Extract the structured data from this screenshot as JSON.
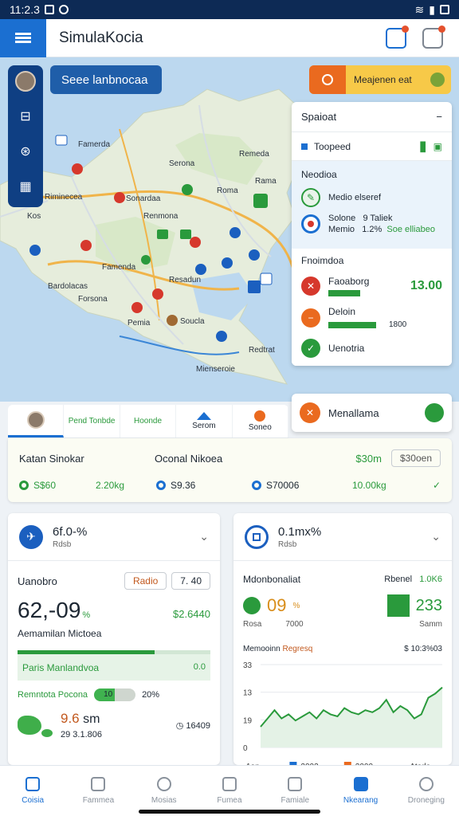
{
  "status_bar": {
    "time": "11:2.3"
  },
  "app": {
    "title": "SimulaKocia"
  },
  "map": {
    "search_label": "Seee lanbnocaa",
    "promo_label": "Meajenen eat",
    "labels": [
      "Famerda",
      "Remeda",
      "Serona",
      "Roma",
      "Sonardaa",
      "Riminecea",
      "Kos",
      "Renmona",
      "Famenda",
      "Forsona",
      "Pemia",
      "Bardolacas",
      "Soucla",
      "Rama",
      "Resadun",
      "Redtrat",
      "Mienseroie"
    ]
  },
  "panel": {
    "title": "Spaioat",
    "row_label": "Toopeed",
    "section_title": "Neodioa",
    "section_item": "Medio elseref",
    "stat_a_label": "Solone",
    "stat_a_value": "9 Taliek",
    "stat_b_label": "Memio",
    "stat_b_value": "1.2%",
    "stat_b_tail": "Soe elliabeo",
    "finance_title": "Fnoimdoa",
    "fin_1_label": "Faoaborg",
    "fin_1_value": "13.00",
    "fin_2_label": "Deloin",
    "fin_2_value": "1800",
    "fin_3_label": "Uenotria"
  },
  "place_card": {
    "label": "Menallama"
  },
  "tabs": [
    {
      "label": ""
    },
    {
      "label": "Pend Tonbde"
    },
    {
      "label": "Hoonde"
    },
    {
      "label": "Serom"
    },
    {
      "label": "Soneo"
    }
  ],
  "summary": {
    "key_1": "Katan Sinokar",
    "key_2": "Oconal Nikoea",
    "value_1": "$30m",
    "button": "$30oen",
    "item_1_label": "S$60",
    "item_1_value": "2.20kg",
    "item_2_label": "S9.36",
    "item_3_label": "S70006",
    "item_3_value": "10.00kg"
  },
  "card_left": {
    "head_value": "6f.0-%",
    "head_sub": "Rdsb",
    "row_label": "Uanobro",
    "pill_1": "Radio",
    "pill_2": "7. 40",
    "big_value": "62,-09",
    "big_pct": "%",
    "green_value": "$2.6440",
    "sub_label": "Aemamilan Mictoea",
    "bar_label": "Paris Manlandvoa",
    "bar_value": "0.0",
    "progress_label": "Remntota Pocona",
    "progress_value": "10",
    "progress_fraction": 0.5,
    "progress_pct": "20%",
    "foot_value": "9.6",
    "foot_unit": "sm",
    "foot_sub": "29 3.1.806",
    "foot_right": "16409"
  },
  "card_right": {
    "head_value": "0.1mx%",
    "head_sub": "Rdsb",
    "row_label": "Mdonbonaliat",
    "row_right_label": "Rbenel",
    "row_right_value": "1.0K6",
    "metric_1": "09",
    "metric_1_pct": "%",
    "metric_1_sub": "Rosa",
    "metric_1_sub2": "7000",
    "metric_2": "233",
    "metric_2_sub": "Samm",
    "chart_title": "Memooinn",
    "chart_title_accent": "Regresq",
    "chart_right": "$ 10:3%03"
  },
  "chart_data": {
    "type": "line",
    "y_ticks": [
      "33",
      "13",
      "19",
      "0"
    ],
    "x_labels": [
      "1on",
      "2003",
      "2000",
      "Aterla"
    ],
    "ylim": [
      0,
      40
    ],
    "values": [
      10,
      14,
      18,
      14,
      16,
      13,
      15,
      17,
      14,
      18,
      16,
      15,
      19,
      17,
      16,
      18,
      17,
      19,
      23,
      17,
      20,
      18,
      14,
      16,
      24,
      26,
      29
    ]
  },
  "bottom_nav": [
    {
      "label": "Coisia"
    },
    {
      "label": "Fammea"
    },
    {
      "label": "Mosias"
    },
    {
      "label": "Fumea"
    },
    {
      "label": "Famiale"
    },
    {
      "label": "Nkearang"
    },
    {
      "label": "Droneging"
    }
  ]
}
